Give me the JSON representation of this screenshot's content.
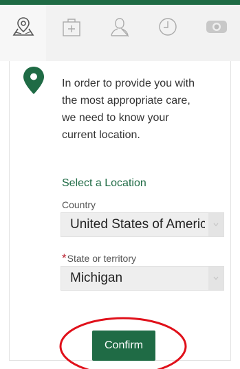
{
  "tabs": [
    {
      "icon": "map-icon",
      "active": true
    },
    {
      "icon": "medical-kit-icon",
      "active": false
    },
    {
      "icon": "person-icon",
      "active": false
    },
    {
      "icon": "clock-icon",
      "active": false
    },
    {
      "icon": "video-camera-icon",
      "active": false
    }
  ],
  "location_prompt": {
    "icon": "location-pin-icon",
    "message": "In order to provide you with the most appropriate care, we need to know your current location."
  },
  "section_title": "Select a Location",
  "country": {
    "label": "Country",
    "value": "United States of America"
  },
  "state": {
    "required_marker": "*",
    "label": "State or territory",
    "value": "Michigan"
  },
  "confirm_label": "Confirm",
  "colors": {
    "brand_green": "#1f6b45",
    "required_red": "#b81c2b",
    "annotation_red": "#e0101a"
  }
}
